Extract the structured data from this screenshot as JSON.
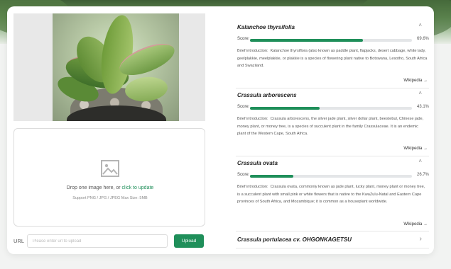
{
  "upload": {
    "drop_text": "Drop one image here, or",
    "update_link": "click to update",
    "hint": "Support PNG / JPG / JPEG Max Size: 5MB"
  },
  "url": {
    "label": "URL",
    "placeholder": "Please enter url to upload",
    "button": "Upload"
  },
  "accent_color": "#1f8f5a",
  "results": [
    {
      "name": "Kalanchoe thyrsifolia",
      "score_label": "Score:",
      "score": 69.6,
      "score_text": "69.6%",
      "intro_label": "Brief introduction:",
      "intro": "Kalanchoe thyrsiflora (also known as paddle plant, flapjacks, desert cabbage, white lady, geelplakkie, meelplakkie, or plakkie is a species of flowering plant native to Botswana, Lesotho, South Africa and Swaziland.",
      "link": "Wikipedia"
    },
    {
      "name": "Crassula arborescens",
      "score_label": "Score:",
      "score": 43.1,
      "score_text": "43.1%",
      "intro_label": "Brief introduction:",
      "intro": "Crassula arborescens, the silver jade plant, silver dollar plant, beestebul, Chinese jade, money plant, or money tree, is a species of succulent plant in the family Crassulaceae. It is an endemic plant of the Western Cape, South Africa.",
      "link": "Wikipedia"
    },
    {
      "name": "Crassula ovata",
      "score_label": "Score:",
      "score": 26.7,
      "score_text": "26.7%",
      "intro_label": "Brief introduction:",
      "intro": "Crassula ovata, commonly known as jade plant, lucky plant, money plant or money tree, is a succulent plant with small pink or white flowers that is native to the KwaZulu-Natal and Eastern Cape provinces of South Africa, and Mozambique; it is common as a houseplant worldwide.",
      "link": "Wikipedia"
    },
    {
      "name": "Crassula portulacea cv. OHGONKAGETSU"
    }
  ]
}
